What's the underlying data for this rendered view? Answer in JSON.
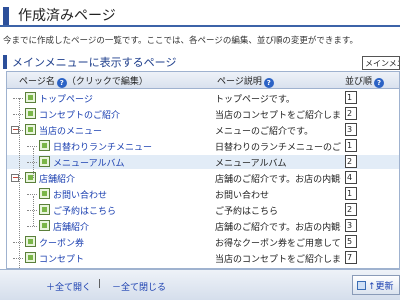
{
  "header": {
    "title": "作成済みページ",
    "description": "今までに作成したページの一覧です。ここでは、各ページの編集、並び順の変更ができます。"
  },
  "section": {
    "title": "メインメニューに表示するページ",
    "side_label": "メインメニ"
  },
  "table": {
    "columns": {
      "name": "ページ名",
      "name_hint": "（クリックで編集）",
      "desc": "ページ説明",
      "order": "並び順"
    },
    "help_glyph": "?",
    "rows": [
      {
        "name": "トップページ",
        "desc": "トップページです。",
        "order": "1",
        "toggle": ""
      },
      {
        "name": "コンセプトのご紹介",
        "desc": "当店のコンセプトをご紹介します。",
        "order": "2",
        "toggle": ""
      },
      {
        "name": "当店のメニュー",
        "desc": "メニューのご紹介です。",
        "order": "3",
        "toggle": "−"
      },
      {
        "name": "日替わりランチメニュー",
        "desc": "日替わりのランチメニューのご紹介",
        "order": "1",
        "toggle": ""
      },
      {
        "name": "メニューアルバム",
        "desc": "メニューアルバム",
        "order": "2",
        "toggle": ""
      },
      {
        "name": "店舗紹介",
        "desc": "店舗のご紹介です。お店の内観や地",
        "order": "4",
        "toggle": "−"
      },
      {
        "name": "お問い合わせ",
        "desc": "お問い合わせ",
        "order": "1",
        "toggle": ""
      },
      {
        "name": "ご予約はこちら",
        "desc": "ご予約はこちら",
        "order": "2",
        "toggle": ""
      },
      {
        "name": "店舗紹介",
        "desc": "店舗のご紹介です。お店の内観や地",
        "order": "3",
        "toggle": ""
      },
      {
        "name": "クーポン券",
        "desc": "お得なクーポン券をご用意しており",
        "order": "5",
        "toggle": ""
      },
      {
        "name": "コンセプト",
        "desc": "当店のコンセプトをご紹介します。",
        "order": "7",
        "toggle": ""
      }
    ]
  },
  "footer": {
    "expand_all": "＋全て開く",
    "separator": "|",
    "collapse_all": "－全て閉じる",
    "update_button": "↑更新"
  },
  "colors": {
    "accent": "#2c4f9a",
    "link": "#1a3fb0",
    "selected_row": "#e2ecf7"
  }
}
